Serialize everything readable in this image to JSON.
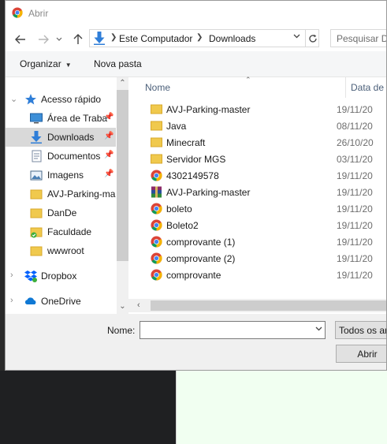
{
  "window": {
    "title": "Abrir"
  },
  "address_bar": {
    "crumbs": [
      "Este Computador",
      "Downloads"
    ],
    "search_placeholder": "Pesquisar Do"
  },
  "toolbar": {
    "organize_label": "Organizar",
    "new_folder_label": "Nova pasta"
  },
  "nav_pane": {
    "items": [
      {
        "label": "Acesso rápido",
        "icon": "star-icon"
      },
      {
        "label": "Área de Traba",
        "icon": "desktop-icon",
        "pinned": true
      },
      {
        "label": "Downloads",
        "icon": "download-icon",
        "pinned": true,
        "selected": true
      },
      {
        "label": "Documentos",
        "icon": "documents-icon",
        "pinned": true
      },
      {
        "label": "Imagens",
        "icon": "images-icon",
        "pinned": true
      },
      {
        "label": "AVJ-Parking-ma",
        "icon": "folder-icon"
      },
      {
        "label": "DanDe",
        "icon": "folder-icon"
      },
      {
        "label": "Faculdade",
        "icon": "folder-icon"
      },
      {
        "label": "wwwroot",
        "icon": "folder-icon"
      },
      {
        "label": "Dropbox",
        "icon": "dropbox-icon"
      },
      {
        "label": "OneDrive",
        "icon": "onedrive-icon"
      }
    ]
  },
  "file_list": {
    "columns": {
      "name": "Nome",
      "date": "Data de m"
    },
    "files": [
      {
        "name": "AVJ-Parking-master",
        "date": "19/11/20",
        "type": "folder"
      },
      {
        "name": "Java",
        "date": "08/11/20",
        "type": "folder"
      },
      {
        "name": "Minecraft",
        "date": "26/10/20",
        "type": "folder"
      },
      {
        "name": "Servidor MGS",
        "date": "03/11/20",
        "type": "folder"
      },
      {
        "name": "4302149578",
        "date": "19/11/20",
        "type": "chrome"
      },
      {
        "name": "AVJ-Parking-master",
        "date": "19/11/20",
        "type": "archive"
      },
      {
        "name": "boleto",
        "date": "19/11/20",
        "type": "chrome"
      },
      {
        "name": "Boleto2",
        "date": "19/11/20",
        "type": "chrome"
      },
      {
        "name": "comprovante (1)",
        "date": "19/11/20",
        "type": "chrome"
      },
      {
        "name": "comprovante (2)",
        "date": "19/11/20",
        "type": "chrome"
      },
      {
        "name": "comprovante",
        "date": "19/11/20",
        "type": "chrome"
      }
    ]
  },
  "footer": {
    "filename_label": "Nome:",
    "filename_value": "",
    "filetype_value": "Todos os arc",
    "open_label": "Abrir"
  },
  "colors": {
    "selected_bg": "#d9d9d9",
    "folder": "#f0c94d",
    "header_text": "#4c607a"
  }
}
